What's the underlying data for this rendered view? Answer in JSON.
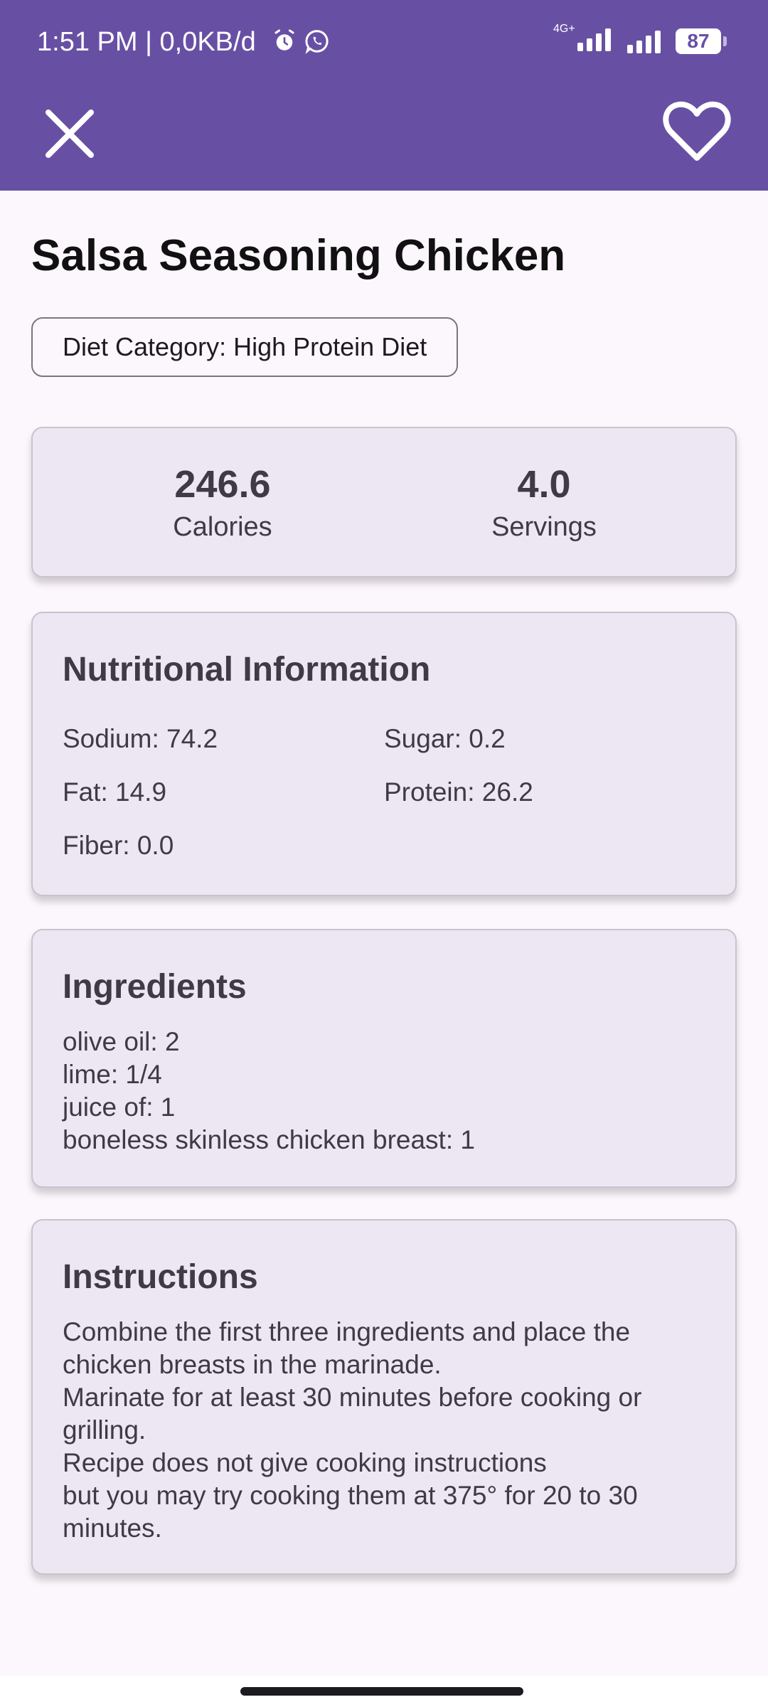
{
  "status_bar": {
    "time": "1:51 PM | 0,0KB/d",
    "network_type": "4G+",
    "battery": "87",
    "icons": [
      "alarm-icon",
      "whatsapp-icon",
      "signal-icon",
      "battery-icon"
    ]
  },
  "app_bar": {
    "close_icon": "close-icon",
    "favorite_icon": "heart-outline-icon"
  },
  "recipe": {
    "title": "Salsa Seasoning Chicken",
    "diet_category": "Diet Category: High Protein Diet"
  },
  "stats": {
    "calories_value": "246.6",
    "calories_label": "Calories",
    "servings_value": "4.0",
    "servings_label": "Servings"
  },
  "nutrition": {
    "title": "Nutritional Information",
    "sodium": "Sodium: 74.2",
    "sugar": "Sugar: 0.2",
    "fat": "Fat: 14.9",
    "protein": "Protein: 26.2",
    "fiber": "Fiber: 0.0"
  },
  "ingredients": {
    "title": "Ingredients",
    "items": [
      "olive oil: 2",
      "lime: 1/4",
      "juice of: 1",
      "boneless skinless chicken breast: 1"
    ]
  },
  "instructions": {
    "title": "Instructions",
    "lines": [
      "Combine the first three ingredients and place the",
      "chicken breasts in the marinade.",
      "Marinate for at least 30 minutes before cooking or",
      "grilling.",
      "Recipe does not give cooking instructions",
      "but you may try cooking them at 375° for 20 to 30",
      "minutes."
    ]
  },
  "colors": {
    "primary": "#6750a4",
    "background": "#fcf7fc",
    "card": "#ede6f3",
    "text": "#3f3a45"
  }
}
